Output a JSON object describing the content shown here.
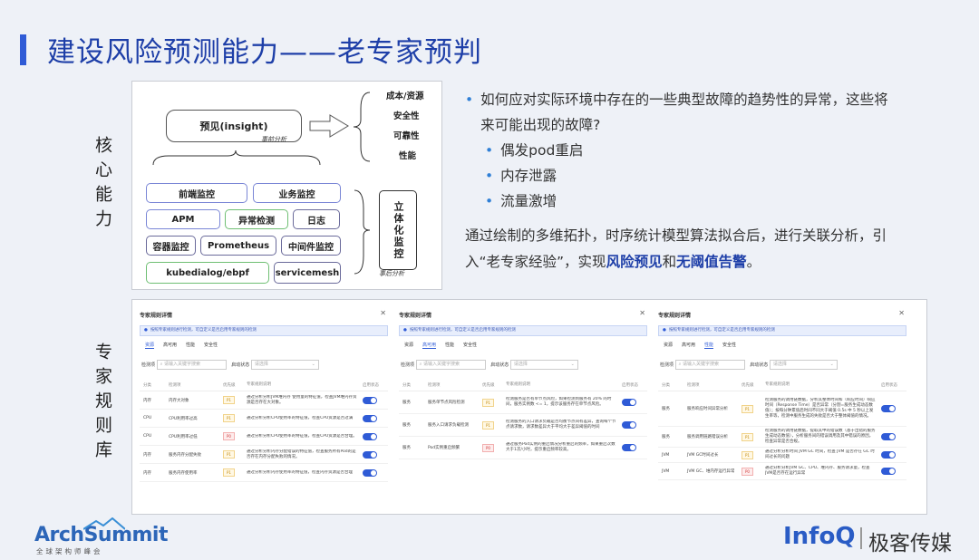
{
  "title": "建设风险预测能力——老专家预判",
  "labels": {
    "core": "核心能力",
    "rules": "专家规则库"
  },
  "diagram": {
    "insight": "预见(insight)",
    "pre_analysis": "事前分析",
    "post_analysis": "事后分析",
    "right_categories": [
      "成本/资源",
      "安全性",
      "可靠性",
      "性能"
    ],
    "stereo": "立体化监控",
    "boxes": [
      "前端监控",
      "业务监控",
      "APM",
      "异常检测",
      "日志",
      "容器监控",
      "Prometheus",
      "中间件监控",
      "kubedialog/ebpf",
      "servicemesh"
    ]
  },
  "bullets": {
    "main": "如何应对实际环境中存在的一些典型故障的趋势性的异常，这些将来可能出现的故障?",
    "subs": [
      "偶发pod重启",
      "内存泄露",
      "流量激增"
    ]
  },
  "paragraph": {
    "part1": "通过绘制的多维拓扑，时序统计模型算法拟合后，进行关联分析，引入“老专家经验”，实现",
    "hl1": "风险预见",
    "and": "和",
    "hl2": "无阈值告警",
    "end": "。"
  },
  "panels": [
    {
      "head": "专家规则详情",
      "info": "按照专家规则进行检测，可自定义是否启用专家规则的检测",
      "tabs": [
        "资源",
        "高可用",
        "性能",
        "安全性"
      ],
      "active_tab": 0,
      "filter_label": "检测项",
      "filter_placeholder": "请输入关键字搜索",
      "status_label": "启动状态",
      "status_placeholder": "请选择",
      "headers": [
        "分类",
        "检测项",
        "优先级",
        "专家规则说明",
        "启用状态"
      ],
      "rows": [
        {
          "cat": "内存",
          "item": "内存大对象",
          "pri": "P1",
          "desc": "通过分析分析JVM堆内存 使用量的特征值，检查JVM堆内存资源是否存在大对象。"
        },
        {
          "cat": "CPU",
          "item": "CPU利用率过高",
          "pri": "P1",
          "desc": "通过分析分析CPU使用率的特征值，检查CPU资源是否过满"
        },
        {
          "cat": "CPU",
          "item": "CPU利用率过低",
          "pri": "P0",
          "desc": "通过分析分析CPU使用率的特征值，检查CPU资源是否合理。"
        },
        {
          "cat": "内存",
          "item": "服务内存分配失败",
          "pri": "P1",
          "desc": "通过分析分析内存分配错误的特征值，检查服务所有Pod的是否存在内存分配失败的情况。"
        },
        {
          "cat": "内存",
          "item": "服务内存使用率",
          "pri": "P1",
          "desc": "通过分析分析内存使用率的特征值，检查内存资源是否合理"
        }
      ]
    },
    {
      "head": "专家规则详情",
      "info": "按照专家规则进行检测，可自定义是否启用专家规则的检测",
      "tabs": [
        "资源",
        "高可用",
        "性能",
        "安全性"
      ],
      "active_tab": 1,
      "filter_label": "检测项",
      "filter_placeholder": "请输入关键字搜索",
      "status_label": "启动状态",
      "status_placeholder": "请选择",
      "headers": [
        "分类",
        "检测项",
        "优先级",
        "专家规则说明",
        "启用状态"
      ],
      "rows": [
        {
          "cat": "服务",
          "item": "服务单节点风险检测",
          "pri": "P1",
          "desc": "检测服务是否有单节点风险，如果检测到服务有 20% 的时间，服务实例数 <= 1，提示该服务存在单节点风险。"
        },
        {
          "cat": "服务",
          "item": "服务入口请求负载检测",
          "pri": "P1",
          "desc": "检测服务的入口请求负载是否均衡节点间有差异，查询每个节点请求数，请求数差异大于平均大于差异阈值的时间"
        },
        {
          "cat": "服务",
          "item": "Pod实例重启频繁",
          "pri": "P0",
          "desc": "通过服务Pod实例的重启情况分析重启的频率，如果重启次数大于1次/小时，提示重启频率较高。"
        }
      ]
    },
    {
      "head": "专家规则详情",
      "info": "按照专家规则进行检测，可自定义是否启用专家规则的检测",
      "tabs": [
        "资源",
        "高可用",
        "性能",
        "安全性"
      ],
      "active_tab": 2,
      "filter_label": "检测项",
      "filter_placeholder": "请输入关键字搜索",
      "status_label": "启动状态",
      "status_placeholder": "请选择",
      "headers": [
        "分类",
        "检测项",
        "优先级",
        "专家规则说明",
        "启用状态"
      ],
      "rows": [
        {
          "cat": "服务",
          "item": "服务响应时间异常分析",
          "pri": "P1",
          "desc": "检测服务的调用链数据，分析其整体时间和（响应时间）响应时间（Response Time）是否异常（分割=服务生成动态数值）；按每分钟累值后时间不同大于阈值 0.5s 中 5 秒以上发生率等，检测中服务生成的失败是否大于整体阈值的情况。"
        },
        {
          "cat": "服务",
          "item": "服务调用链路错误分析",
          "pri": "P1",
          "desc": "检测服务的调用链数据，提取其中的错误数（基于出错的服务生成动态数值），分析服务间的错误调用及其中错误的原因，检查异常是否合规。"
        },
        {
          "cat": "JVM",
          "item": "JVM GC时间过长",
          "pri": "P1",
          "desc": "通过分析分析时间 JVM GC 时间，检查 JVM 是否存在 GC 时间过长的问题"
        },
        {
          "cat": "JVM",
          "item": "JVM GC、堆内存运行异常",
          "pri": "P0",
          "desc": "通过分析分析JVM GC、CPU、堆内存、服务请求量，检查JVM是否存在运行异常"
        }
      ]
    }
  ],
  "footer": {
    "left_logo": "ArchSummit",
    "left_sub": "全球架构师峰会",
    "right_logo": "InfoQ",
    "right_text": "极客传媒"
  },
  "colors": {
    "accent": "#2f5bd6",
    "title": "#1e3fa8",
    "toggle": "#2f5bd6"
  }
}
